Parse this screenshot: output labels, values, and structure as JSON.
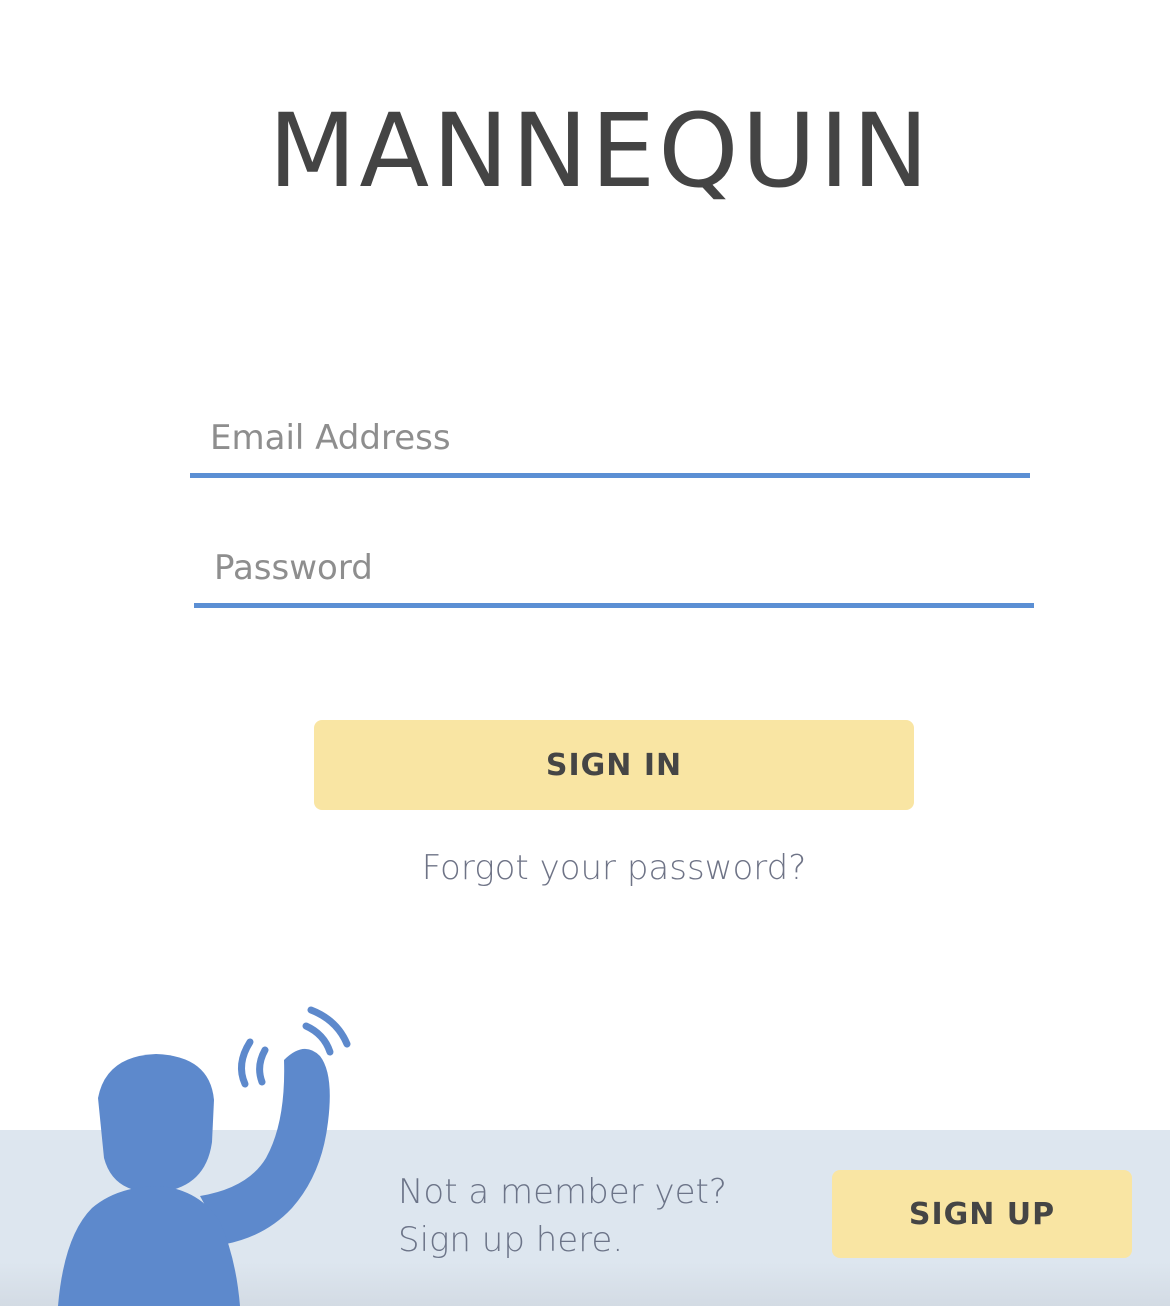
{
  "app": {
    "title": "MANNEQUIN"
  },
  "login_form": {
    "email": {
      "placeholder": "Email Address",
      "value": ""
    },
    "password": {
      "placeholder": "Password",
      "value": ""
    },
    "signin_label": "SIGN IN",
    "forgot_label": "Forgot your password?"
  },
  "footer": {
    "prompt_line1": "Not a member yet?",
    "prompt_line2": "Sign up here.",
    "signup_label": "SIGN UP",
    "mascot_icon": "waving-person-icon"
  },
  "colors": {
    "accent_blue": "#5b8fd4",
    "button_yellow": "#f9e5a3",
    "footer_band": "#dde6ef",
    "title_text": "#444444"
  }
}
